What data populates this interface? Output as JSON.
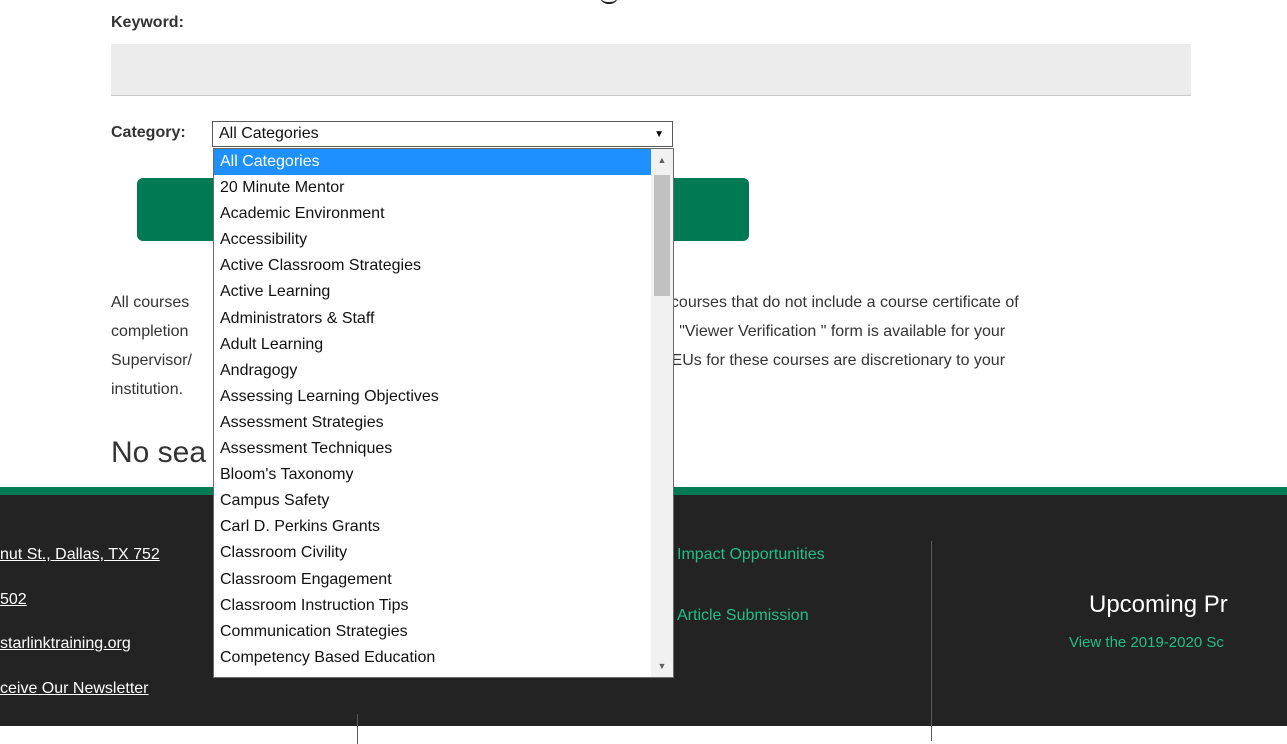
{
  "form": {
    "keyword_label": "Keyword:",
    "keyword_value": "",
    "category_label": "Category:",
    "category_selected": "All Categories"
  },
  "category_options": [
    "All Categories",
    "20 Minute Mentor",
    "Academic Environment",
    "Accessibility",
    "Active Classroom Strategies",
    "Active Learning",
    "Administrators & Staff",
    "Adult Learning",
    "Andragogy",
    "Assessing Learning Objectives",
    "Assessment Strategies",
    "Assessment Techniques",
    "Bloom's Taxonomy",
    "Campus Safety",
    "Carl D. Perkins Grants",
    "Classroom Civility",
    "Classroom Engagement",
    "Classroom Instruction Tips",
    "Communication Strategies",
    "Competency Based Education"
  ],
  "notice": {
    "line1_left": "All courses",
    "line1_right": "pment courses that do not include a course certificate of",
    "line2_left": "completion",
    "line2_right": "he \"Viewer Verification \" form is available for your",
    "line3_left": "Supervisor/",
    "line3_right": "CEUs for these courses are discretionary to your",
    "line4_left": "institution."
  },
  "results": {
    "no_results_partial": "No sea"
  },
  "footer": {
    "address_partial": "nut St., Dallas, TX 752",
    "phone_partial": "502",
    "email_partial": "starlinktraining.org",
    "newsletter_partial": "ceive Our Newsletter",
    "impact_link": "Impact Opportunities",
    "article_link": "Article Submission",
    "upcoming_title_partial": "Upcoming Pr",
    "schedule_link_partial": "View the 2019-2020 Sc"
  },
  "colors": {
    "accent_green": "#007a52",
    "footer_link_green": "#1fbf86",
    "footer_bg": "#232323",
    "selected_option_bg": "#1e90ff"
  }
}
